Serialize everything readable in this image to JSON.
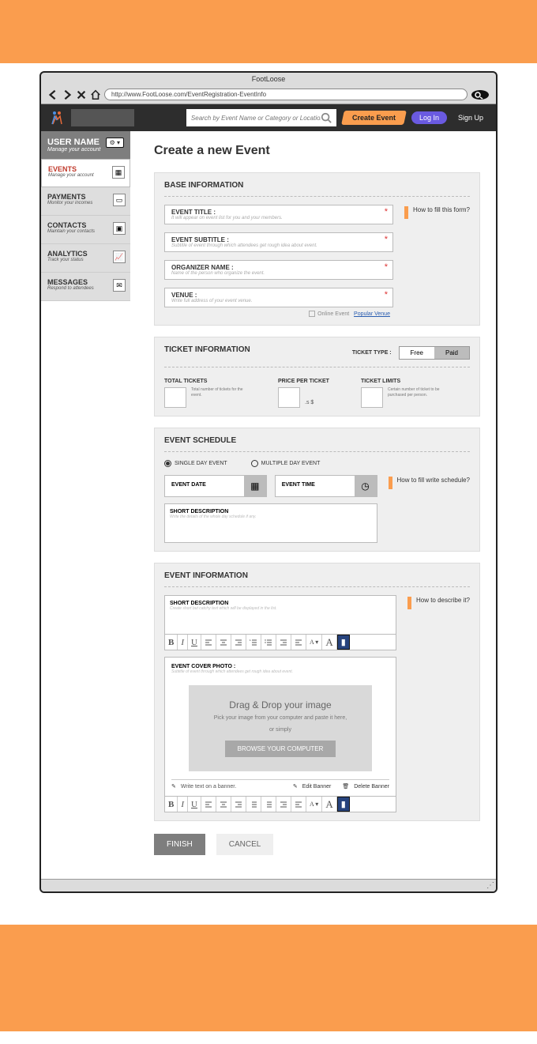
{
  "browser": {
    "title": "FootLoose",
    "url": "http://www.FootLoose.com/EventRegistration-EventInfo"
  },
  "header": {
    "search_placeholder": "Search by Event Name or Category or Location",
    "create_event": "Create Event",
    "login": "Log In",
    "signup": "Sign Up"
  },
  "sidebar": {
    "user": {
      "name": "USER NAME",
      "sub": "Manage your account"
    },
    "items": [
      {
        "title": "EVENTS",
        "sub": "Manage your account"
      },
      {
        "title": "PAYMENTS",
        "sub": "Monitor your incomes"
      },
      {
        "title": "CONTACTS",
        "sub": "Maintain your contacts"
      },
      {
        "title": "ANALYTICS",
        "sub": "Track your status"
      },
      {
        "title": "MESSAGES",
        "sub": "Respond to attendees"
      }
    ]
  },
  "page": {
    "title": "Create a new Event"
  },
  "base": {
    "heading": "BASE INFORMATION",
    "helper": "How to fill this form?",
    "fields": {
      "title": {
        "label": "EVENT TITLE :",
        "hint": "It will appear on event list for you and your members."
      },
      "subtitle": {
        "label": "EVENT SUBTITLE :",
        "hint": "Subtitle of event through which attendees get rough idea about event."
      },
      "organizer": {
        "label": "ORGANIZER NAME :",
        "hint": "Name of the person who organize the event."
      },
      "venue": {
        "label": "VENUE :",
        "hint": "Write full address of your event venue."
      }
    },
    "online_event": "Online Event",
    "popular_venue": "Popular Venue"
  },
  "tickets": {
    "heading": "TICKET INFORMATION",
    "type_label": "TICKET TYPE :",
    "free": "Free",
    "paid": "Paid",
    "total": {
      "h": "TOTAL TICKETS",
      "txt": "Total number of tickets for the event."
    },
    "price": {
      "h": "PRICE PER TICKET",
      "unit": ".s $"
    },
    "limits": {
      "h": "TICKET LIMITS",
      "txt": "Certain number of ticket to be purchased per person."
    }
  },
  "schedule": {
    "heading": "EVENT SCHEDULE",
    "single": "SINGLE DAY EVENT",
    "multiple": "MULTIPLE DAY EVENT",
    "date_label": "EVENT DATE",
    "time_label": "EVENT TIME",
    "helper": "How to fill write schedule?",
    "short_desc": {
      "label": "SHORT DESCRIPTION",
      "hint": "Write the details of the whole day schedule if any."
    }
  },
  "info": {
    "heading": "EVENT INFORMATION",
    "helper": "How to describe it?",
    "short_desc": {
      "label": "SHORT DESCRIPTION",
      "hint": "Create short but catchy text which will be displayed in the list."
    },
    "cover": {
      "label": "EVENT COVER PHOTO :",
      "hint": "Subtitle of event through which attendees get rough idea about event.",
      "dz_title": "Drag & Drop your image",
      "dz_sub": "Pick your image from your computer and paste it here,",
      "dz_or": "or simply",
      "browse": "BROWSE YOUR COMPUTER",
      "write_text": "Write text on a banner.",
      "edit": "Edit Banner",
      "delete": "Delete Banner"
    }
  },
  "actions": {
    "finish": "FINISH",
    "cancel": "CANCEL"
  }
}
